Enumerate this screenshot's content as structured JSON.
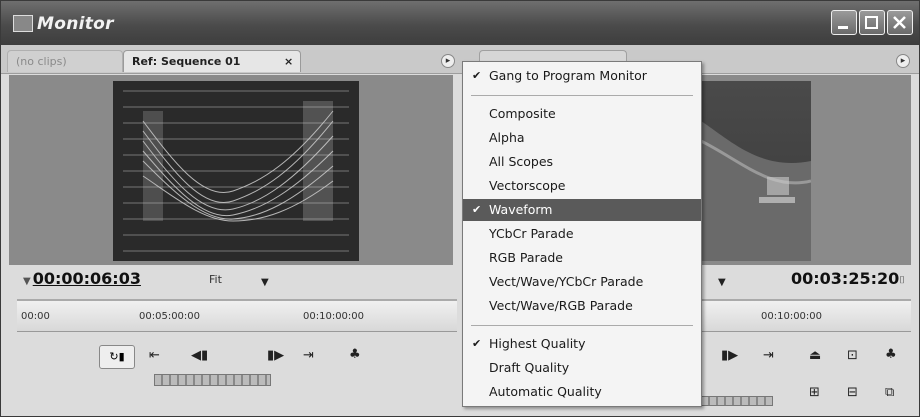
{
  "window": {
    "title": "Monitor",
    "buttons": [
      "minimize",
      "maximize",
      "close"
    ]
  },
  "tabs": [
    {
      "label": "(no clips)",
      "close": ""
    },
    {
      "label": "Ref: Sequence 01",
      "close": "×"
    }
  ],
  "source": {
    "timecode": "00:00:06:03",
    "zoom": "Fit",
    "ruler_ticks": [
      "00:00",
      "00:05:00:00",
      "00:10:00:00"
    ]
  },
  "program": {
    "timecode": "00:03:25:20",
    "ruler_ticks": [
      "00:10:00:00"
    ]
  },
  "menu": {
    "items": [
      {
        "label": "Gang to Program Monitor",
        "checked": true,
        "highlighted": false
      },
      {
        "separator": true
      },
      {
        "label": "Composite",
        "checked": false,
        "highlighted": false
      },
      {
        "label": "Alpha",
        "checked": false,
        "highlighted": false
      },
      {
        "label": "All Scopes",
        "checked": false,
        "highlighted": false
      },
      {
        "label": "Vectorscope",
        "checked": false,
        "highlighted": false
      },
      {
        "label": "Waveform",
        "checked": true,
        "highlighted": true
      },
      {
        "label": "YCbCr Parade",
        "checked": false,
        "highlighted": false
      },
      {
        "label": "RGB Parade",
        "checked": false,
        "highlighted": false
      },
      {
        "label": "Vect/Wave/YCbCr Parade",
        "checked": false,
        "highlighted": false
      },
      {
        "label": "Vect/Wave/RGB Parade",
        "checked": false,
        "highlighted": false
      },
      {
        "separator": true
      },
      {
        "label": "Highest Quality",
        "checked": true,
        "highlighted": false
      },
      {
        "label": "Draft Quality",
        "checked": false,
        "highlighted": false
      },
      {
        "label": "Automatic Quality",
        "checked": false,
        "highlighted": false
      }
    ]
  },
  "colors": {
    "titlebar": "#4b4b4b",
    "menu_highlight": "#5a5a5a"
  }
}
